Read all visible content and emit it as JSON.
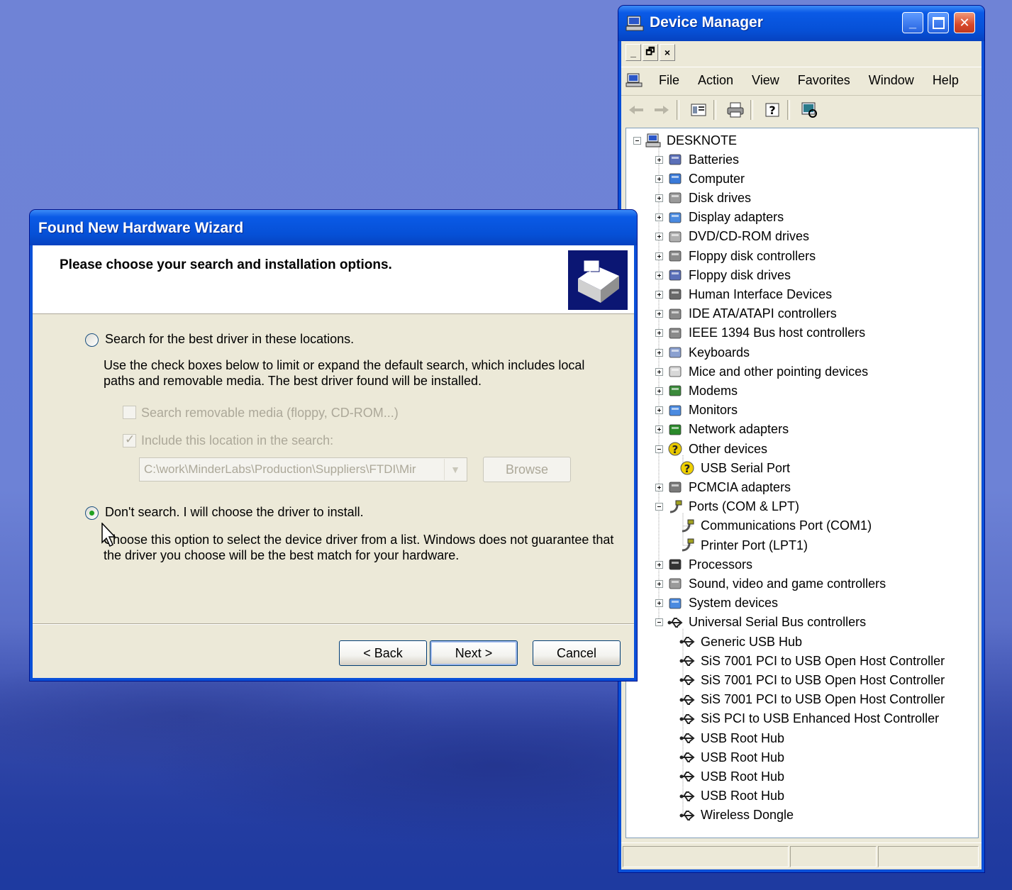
{
  "device_manager": {
    "title": "Device Manager",
    "mdi_buttons": [
      "_",
      "🗗",
      "×"
    ],
    "menu": [
      "File",
      "Action",
      "View",
      "Favorites",
      "Window",
      "Help"
    ],
    "toolbar_icons": [
      "back-arrow-icon",
      "forward-arrow-icon",
      "properties-icon",
      "print-icon",
      "help-icon",
      "scan-hardware-icon"
    ],
    "root": "DESKNOTE",
    "tree": [
      {
        "label": "Batteries",
        "level": 1,
        "expander": "plus",
        "icon": "battery-icon"
      },
      {
        "label": "Computer",
        "level": 1,
        "expander": "plus",
        "icon": "computer-icon"
      },
      {
        "label": "Disk drives",
        "level": 1,
        "expander": "plus",
        "icon": "disk-drive-icon"
      },
      {
        "label": "Display adapters",
        "level": 1,
        "expander": "plus",
        "icon": "display-adapter-icon"
      },
      {
        "label": "DVD/CD-ROM drives",
        "level": 1,
        "expander": "plus",
        "icon": "cdrom-icon"
      },
      {
        "label": "Floppy disk controllers",
        "level": 1,
        "expander": "plus",
        "icon": "controller-icon"
      },
      {
        "label": "Floppy disk drives",
        "level": 1,
        "expander": "plus",
        "icon": "floppy-icon"
      },
      {
        "label": "Human Interface Devices",
        "level": 1,
        "expander": "plus",
        "icon": "hid-icon"
      },
      {
        "label": "IDE ATA/ATAPI controllers",
        "level": 1,
        "expander": "plus",
        "icon": "controller-icon"
      },
      {
        "label": "IEEE 1394 Bus host controllers",
        "level": 1,
        "expander": "plus",
        "icon": "ieee1394-icon"
      },
      {
        "label": "Keyboards",
        "level": 1,
        "expander": "plus",
        "icon": "keyboard-icon"
      },
      {
        "label": "Mice and other pointing devices",
        "level": 1,
        "expander": "plus",
        "icon": "mouse-icon"
      },
      {
        "label": "Modems",
        "level": 1,
        "expander": "plus",
        "icon": "modem-icon"
      },
      {
        "label": "Monitors",
        "level": 1,
        "expander": "plus",
        "icon": "monitor-icon"
      },
      {
        "label": "Network adapters",
        "level": 1,
        "expander": "plus",
        "icon": "network-adapter-icon"
      },
      {
        "label": "Other devices",
        "level": 1,
        "expander": "minus",
        "icon": "unknown-device-icon"
      },
      {
        "label": "USB Serial Port",
        "level": 2,
        "expander": "none",
        "icon": "warning-device-icon"
      },
      {
        "label": "PCMCIA adapters",
        "level": 1,
        "expander": "plus",
        "icon": "pcmcia-icon"
      },
      {
        "label": "Ports (COM & LPT)",
        "level": 1,
        "expander": "minus",
        "icon": "port-icon"
      },
      {
        "label": "Communications Port (COM1)",
        "level": 2,
        "expander": "none",
        "icon": "port-icon"
      },
      {
        "label": "Printer Port (LPT1)",
        "level": 2,
        "expander": "none",
        "icon": "port-icon"
      },
      {
        "label": "Processors",
        "level": 1,
        "expander": "plus",
        "icon": "processor-icon"
      },
      {
        "label": "Sound, video and game controllers",
        "level": 1,
        "expander": "plus",
        "icon": "sound-icon"
      },
      {
        "label": "System devices",
        "level": 1,
        "expander": "plus",
        "icon": "system-device-icon"
      },
      {
        "label": "Universal Serial Bus controllers",
        "level": 1,
        "expander": "minus",
        "icon": "usb-icon"
      },
      {
        "label": "Generic USB Hub",
        "level": 2,
        "expander": "none",
        "icon": "usb-icon"
      },
      {
        "label": "SiS 7001 PCI to USB Open Host Controller",
        "level": 2,
        "expander": "none",
        "icon": "usb-icon"
      },
      {
        "label": "SiS 7001 PCI to USB Open Host Controller",
        "level": 2,
        "expander": "none",
        "icon": "usb-icon"
      },
      {
        "label": "SiS 7001 PCI to USB Open Host Controller",
        "level": 2,
        "expander": "none",
        "icon": "usb-icon"
      },
      {
        "label": "SiS PCI to USB Enhanced Host Controller",
        "level": 2,
        "expander": "none",
        "icon": "usb-icon"
      },
      {
        "label": "USB Root Hub",
        "level": 2,
        "expander": "none",
        "icon": "usb-icon"
      },
      {
        "label": "USB Root Hub",
        "level": 2,
        "expander": "none",
        "icon": "usb-icon"
      },
      {
        "label": "USB Root Hub",
        "level": 2,
        "expander": "none",
        "icon": "usb-icon"
      },
      {
        "label": "USB Root Hub",
        "level": 2,
        "expander": "none",
        "icon": "usb-icon"
      },
      {
        "label": "Wireless Dongle",
        "level": 2,
        "expander": "none",
        "icon": "usb-icon"
      }
    ]
  },
  "wizard": {
    "title": "Found New Hardware Wizard",
    "heading": "Please choose your search and installation options.",
    "option_search": {
      "label": "Search for the best driver in these locations.",
      "selected": false,
      "description_line1": "Use the check boxes below to limit or expand the default search, which includes local",
      "description_line2": "paths and removable media. The best driver found will be installed.",
      "check_removable": {
        "label": "Search removable media (floppy, CD-ROM...)",
        "checked": false
      },
      "check_location": {
        "label": "Include this location in the search:",
        "checked": true
      },
      "path_value": "C:\\work\\MinderLabs\\Production\\Suppliers\\FTDI\\Mir",
      "browse_label": "Browse"
    },
    "option_dont_search": {
      "label": "Don't search. I will choose the driver to install.",
      "selected": true,
      "description_line1": "Choose this option to select the device driver from a list.  Windows does not guarantee that",
      "description_line2": "the driver you choose will be the best match for your hardware."
    },
    "buttons": {
      "back": "< Back",
      "next": "Next >",
      "cancel": "Cancel"
    }
  },
  "colors": {
    "xp_title_blue": "#0a50d8",
    "dialog_face": "#ece9d8",
    "radio_selected": "#21a121",
    "disabled_text": "#aca899"
  }
}
